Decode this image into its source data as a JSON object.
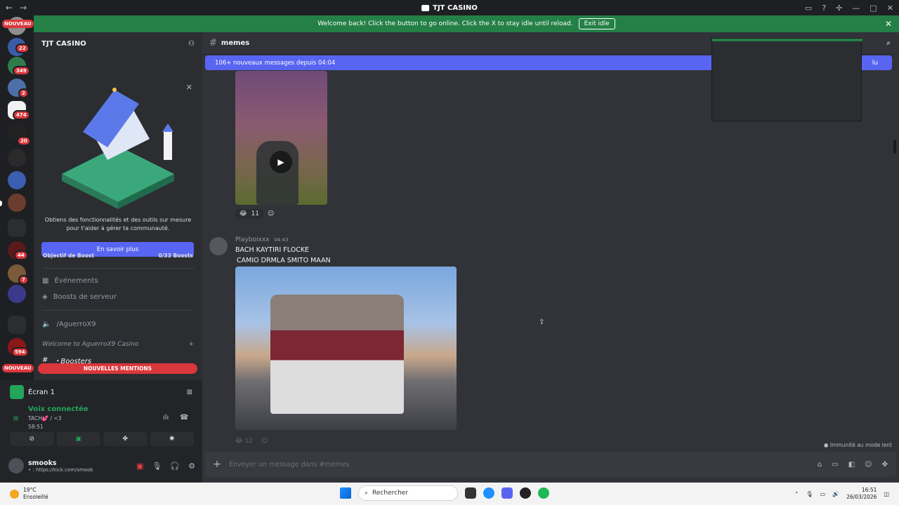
{
  "titlebar": {
    "title": "TJT CASINO",
    "nav_back": "←",
    "nav_forward": "→"
  },
  "banner": {
    "text": "Welcome back! Click the button to go online. Click the X to stay idle until reload.",
    "button": "Exit idle",
    "close": "✕"
  },
  "rail": {
    "new_top": "NOUVEAU",
    "new_bottom": "NOUVEAU",
    "badges": [
      "22",
      "349",
      "2",
      "474",
      "20",
      "44",
      "7",
      "594"
    ]
  },
  "sidebar": {
    "guild_name": "TJT CASINO",
    "promo_text_1": "Obtiens des fonctionnalités et des outils sur mesure",
    "promo_text_2": "pour t'aider à gérer ta communauté.",
    "promo_button": "En savoir plus",
    "boost_label": "Objectif de Boost",
    "boost_value": "0/33 Boosts",
    "events": "Événements",
    "server_boosts": "Boosts de serveur",
    "voice_channel": "/AguerroX9",
    "category": "Welcome to AguerroX9 Casino",
    "channel_boosters": "・Boosters",
    "mentions": "NOUVELLES MENTIONS"
  },
  "panel": {
    "screen": "Écran 1",
    "voice_status": "Voix connectée",
    "voice_channel": "TACH💕 / <3",
    "timer": "58:51",
    "username": "smooks",
    "user_status": "• : https://kick.com/smook"
  },
  "chat": {
    "channel": "memes",
    "new_messages": "106+ nouveaux messages depuis 04:04",
    "new_messages_mark": "lu",
    "reaction_count": "11",
    "author": "Playboixxx",
    "time": "04:43",
    "line1": "BACH KAYTIRI FLOCKE",
    "line2": "CAMIO DRMLA SMITO MAAN",
    "reaction2_count": "12",
    "immunity": "Immunité au mode lent",
    "composer_placeholder": "Envoyer un message dans #memes"
  },
  "taskbar": {
    "temp": "19°C",
    "weather": "Ensoleillé",
    "search": "Rechercher",
    "time": "16:51",
    "date": "26/03/2026"
  }
}
